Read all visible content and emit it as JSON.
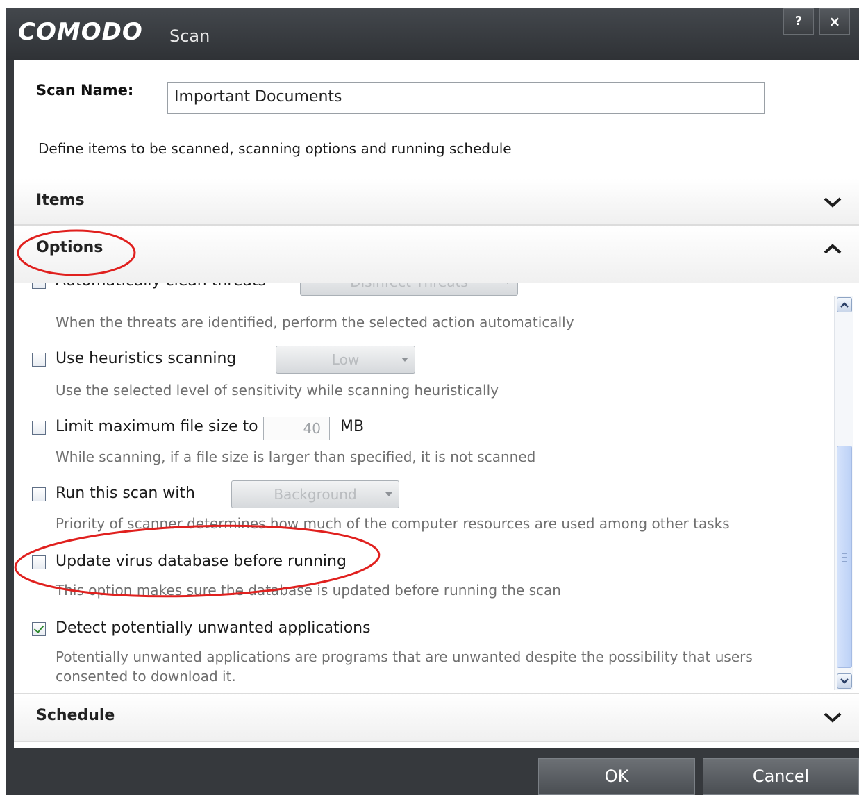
{
  "window": {
    "logo": "COMODO",
    "title": "Scan",
    "help_label": "?",
    "close_label": "×"
  },
  "scan": {
    "name_label": "Scan Name:",
    "name_value": "Important Documents",
    "description": "Define items to be scanned, scanning options and running schedule"
  },
  "sections": {
    "items": "Items",
    "options": "Options",
    "schedule": "Schedule"
  },
  "options": {
    "auto_clean": {
      "label": "Automatically clean threats",
      "select": "Disinfect Threats",
      "description": "When the threats are identified, perform the selected action automatically",
      "checked": false
    },
    "heuristics": {
      "label": "Use heuristics scanning",
      "select": "Low",
      "description": "Use the selected level of sensitivity while scanning heuristically",
      "checked": false
    },
    "limit_size": {
      "label": "Limit maximum file size to",
      "value": "40",
      "unit": "MB",
      "description": "While scanning, if a file size is larger than specified, it is not scanned",
      "checked": false
    },
    "priority": {
      "label": "Run this scan with",
      "select": "Background",
      "description": "Priority of scanner determines how much of the computer resources are used among other tasks",
      "checked": false
    },
    "update_db": {
      "label": "Update virus database before running",
      "description": "This option makes sure the database is updated before running the scan",
      "checked": false
    },
    "detect_pua": {
      "label": "Detect potentially unwanted applications",
      "description_line1": "Potentially unwanted applications are programs that are unwanted despite the possibility that users",
      "description_line2": "consented to download it.",
      "checked": true
    }
  },
  "footer": {
    "ok_label": "OK",
    "cancel_label": "Cancel"
  },
  "colors": {
    "titlebar": "#36393d",
    "annotation": "#e0201e",
    "check": "#2f8a2f"
  },
  "icons": [
    "chevron-down-icon",
    "chevron-up-icon",
    "scroll-up-icon",
    "scroll-down-icon",
    "checkmark-icon"
  ]
}
